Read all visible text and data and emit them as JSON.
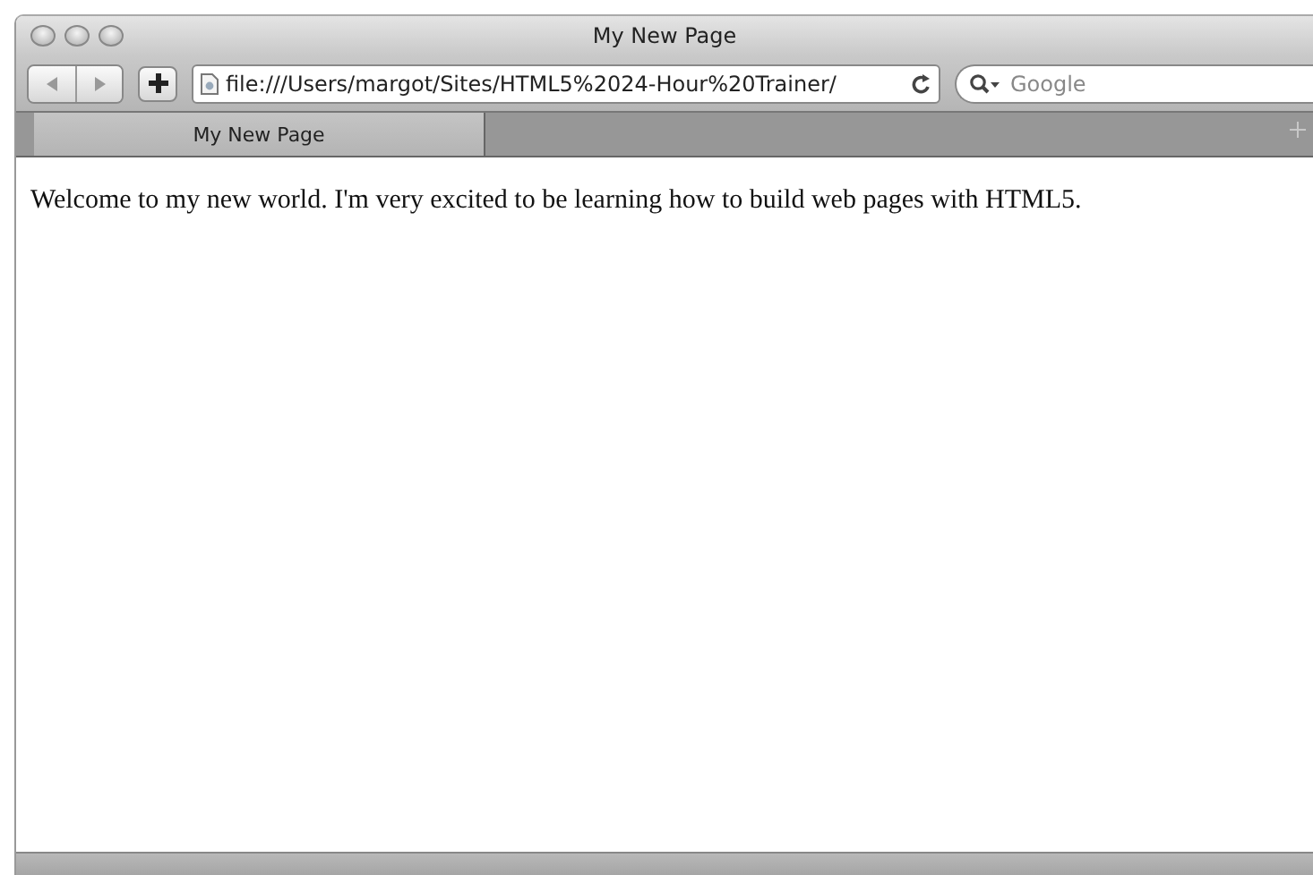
{
  "window": {
    "title": "My New Page"
  },
  "toolbar": {
    "address": "file:///Users/margot/Sites/HTML5%2024-Hour%20Trainer/",
    "search": {
      "placeholder": "Google"
    }
  },
  "tabs": [
    {
      "label": "My New Page",
      "selected": true
    }
  ],
  "content": {
    "text": "Welcome to my new world. I'm very excited to be learning how to build web pages with HTML5."
  }
}
